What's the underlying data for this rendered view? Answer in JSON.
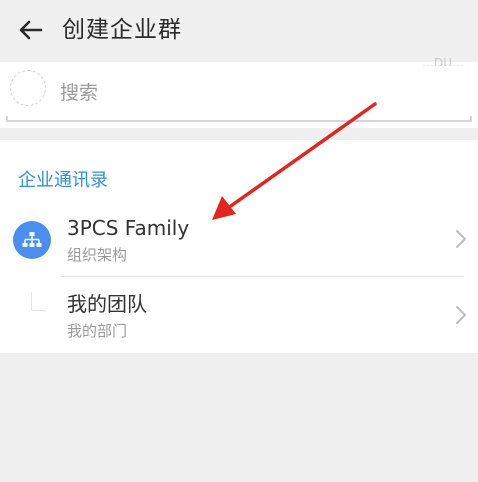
{
  "header": {
    "title": "创建企业群",
    "back_icon": "arrow-left-icon"
  },
  "search": {
    "corner_text": "…DU…",
    "label": "搜索"
  },
  "section": {
    "title": "企业通讯录"
  },
  "rows": [
    {
      "title": "3PCS Family",
      "subtitle": "组织架构",
      "icon": "org-chart-icon"
    },
    {
      "title": "我的团队",
      "subtitle": "我的部门",
      "icon": "team-icon"
    }
  ],
  "colors": {
    "accent_blue": "#2f8fe0",
    "icon_blue": "#4a8ff0",
    "annotation_red": "#e0261e",
    "background": "#efefef"
  }
}
